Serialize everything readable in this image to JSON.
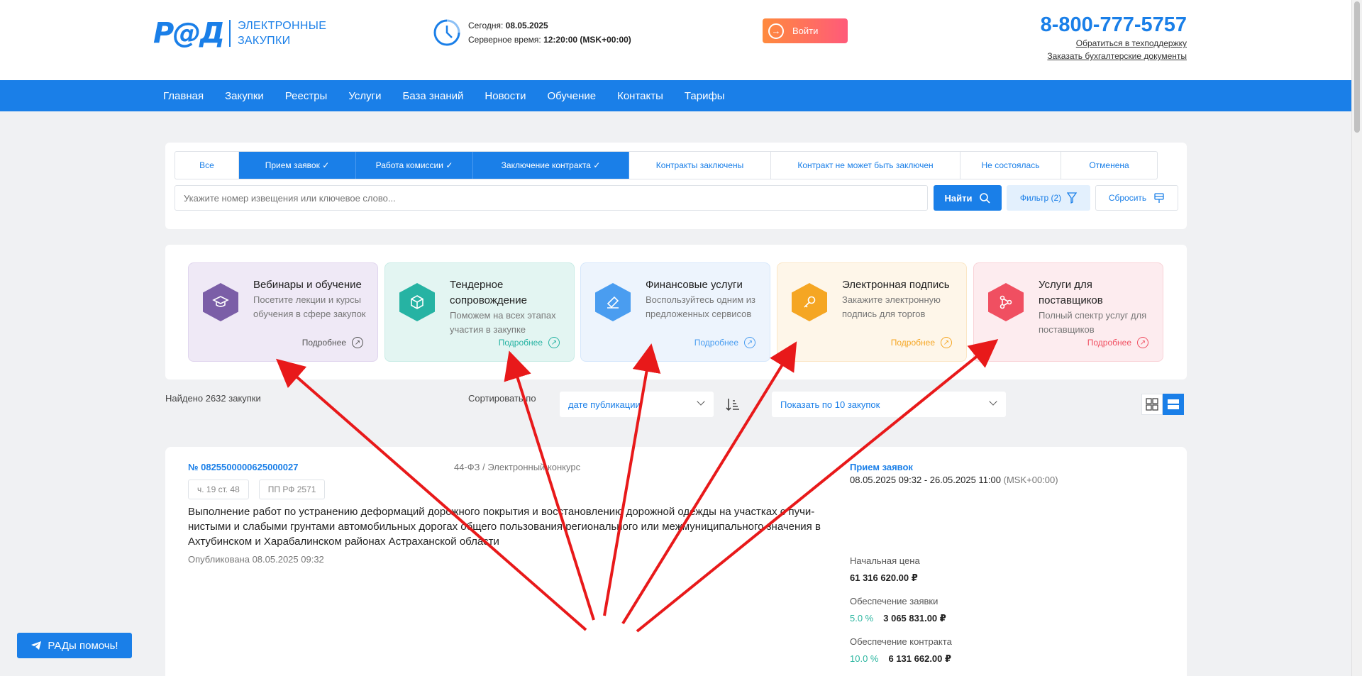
{
  "header": {
    "logo_mark": "Р@Д",
    "logo_line1": "ЭЛЕКТРОННЫЕ",
    "logo_line2": "ЗАКУПКИ",
    "today_label": "Сегодня: ",
    "today_value": "08.05.2025",
    "server_label": "Серверное время: ",
    "server_value": "12:20:00 (MSK+00:00)",
    "login_label": "Войти",
    "phone": "8-800-777-5757",
    "support_link": "Обратиться в техподдержку",
    "docs_link": "Заказать бухгалтерские документы"
  },
  "nav": [
    "Главная",
    "Закупки",
    "Реестры",
    "Услуги",
    "База знаний",
    "Новости",
    "Обучение",
    "Контакты",
    "Тарифы"
  ],
  "tabs": [
    {
      "label": "Все",
      "active": false
    },
    {
      "label": "Прием заявок",
      "active": true
    },
    {
      "label": "Работа комиссии",
      "active": true
    },
    {
      "label": "Заключение контракта",
      "active": true
    },
    {
      "label": "Контракты заключены",
      "active": false
    },
    {
      "label": "Контракт не может быть заключен",
      "active": false
    },
    {
      "label": "Не состоялась",
      "active": false
    },
    {
      "label": "Отменена",
      "active": false
    }
  ],
  "search": {
    "placeholder": "Укажите номер извещения или ключевое слово...",
    "find_label": "Найти",
    "filter_label": "Фильтр (2)",
    "reset_label": "Сбросить"
  },
  "services": [
    {
      "title": "Вебинары и обучение",
      "desc": "Посетите лекции и курсы обучения в сфере закупок",
      "more": "Подробнее",
      "color": "#7b5ea7",
      "bg": "#efe9f6",
      "border": "#e0d5ee",
      "icon": "graduation-cap-icon"
    },
    {
      "title": "Тендерное сопровождение",
      "desc": "Поможем на всех этапах участия в закупке",
      "more": "Подробнее",
      "color": "#26b3a3",
      "bg": "#e3f5f2",
      "border": "#c9ece6",
      "icon": "cube-icon"
    },
    {
      "title": "Финансовые услуги",
      "desc": "Воспользуйтесь одним из предложенных сервисов",
      "more": "Подробнее",
      "color": "#4a9df0",
      "bg": "#edf4fd",
      "border": "#d6e7fb",
      "icon": "document-icon"
    },
    {
      "title": "Электронная подпись",
      "desc": "Закажите электронную подпись для торгов",
      "more": "Подробнее",
      "color": "#f5a623",
      "bg": "#fef6e9",
      "border": "#fbe6c6",
      "icon": "key-icon"
    },
    {
      "title": "Услуги для поставщиков",
      "desc": "Полный спектр услуг для поставщиков",
      "more": "Подробнее",
      "color": "#f04f61",
      "bg": "#fdecef",
      "border": "#f9d3d8",
      "icon": "nodes-icon"
    }
  ],
  "results": {
    "found": "Найдено 2632 закупки",
    "sort_label": "Сортировать по",
    "sort_value": "дате публикации",
    "page_size": "Показать по 10 закупок"
  },
  "card": {
    "number": "№ 0825500000625000027",
    "law": "44-ФЗ / Электронный конкурс",
    "tags": [
      "ч. 19 ст. 48",
      "ПП РФ 2571"
    ],
    "description": "Выполнение работ по устранению деформаций дорожного покрытия и восстановлению дорожной одежды на участках с пучи-нистыми и слабыми грунтами автомобильных дорогах общего пользования регионального или межмуниципального значения в Ахтубинском и Харабалинском районах Астраханской области",
    "published": "Опубликована 08.05.2025 09:32",
    "status": "Прием заявок",
    "dates": "08.05.2025 09:32 - 26.05.2025 11:00 ",
    "tz": "(MSK+00:00)",
    "price_label": "Начальная цена",
    "price_value": "61 316 620.00 ₽",
    "bid_sec_label": "Обеспечение заявки",
    "bid_sec_pct": "5.0 %",
    "bid_sec_value": "3 065 831.00 ₽",
    "contract_sec_label": "Обеспечение контракта",
    "contract_sec_pct": "10.0 %",
    "contract_sec_value": "6 131 662.00 ₽"
  },
  "help_label": "РАДы помочь!",
  "colors": {
    "primary": "#1a7fe8",
    "arrow": "#e8191a"
  }
}
